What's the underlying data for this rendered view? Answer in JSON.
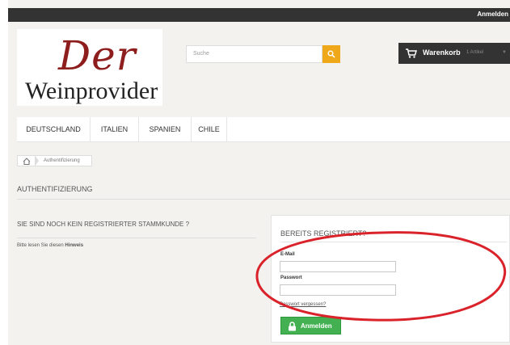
{
  "topbar": {
    "login": "Anmelden"
  },
  "logo": {
    "line1": "Der",
    "line2": "Weinprovider"
  },
  "search": {
    "placeholder": "Suche"
  },
  "cart": {
    "title": "Warenkorb",
    "count": "1 Artikel"
  },
  "menu": {
    "items": [
      "DEUTSCHLAND",
      "ITALIEN",
      "SPANIEN",
      "CHILE"
    ]
  },
  "breadcrumb": {
    "current": "Authentifizierung"
  },
  "page_title": "AUTHENTIFIZIERUNG",
  "left": {
    "heading": "SIE SIND NOCH KEIN REGISTRIERTER STAMMKUNDE ?",
    "text": "Bitte lesen Sie diesen",
    "link": "Hinweis"
  },
  "login_form": {
    "heading": "BEREITS REGISTRIERT?",
    "email_label": "E-Mail",
    "password_label": "Passwort",
    "forgot": "Passwort vergessen?",
    "button": "Anmelden"
  },
  "colors": {
    "accent_orange": "#f0a81b",
    "button_green": "#43b152",
    "annotation_red": "#d9222a",
    "logo_red": "#8e1d1d"
  }
}
